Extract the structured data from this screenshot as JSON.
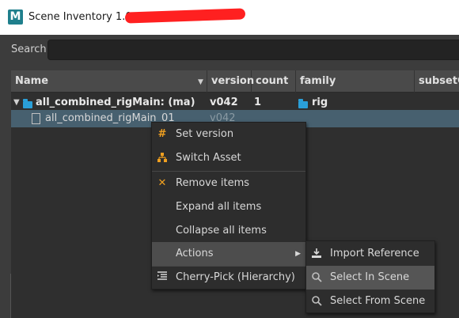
{
  "window": {
    "app_icon_letter": "M",
    "title": "Scene Inventory 1.0 -"
  },
  "search": {
    "label": "Search",
    "placeholder": ""
  },
  "columns": {
    "name": "Name",
    "version": "version",
    "count": "count",
    "family": "family",
    "subset": "subsetGroup"
  },
  "rows": [
    {
      "name": "all_combined_rigMain: (ma)",
      "version": "v042",
      "count": "1",
      "family": "rig"
    },
    {
      "name": "all_combined_rigMain_01",
      "version": "v042"
    }
  ],
  "context_menu": {
    "items": [
      {
        "label": "Set version",
        "icon": "hash-icon"
      },
      {
        "label": "Switch Asset",
        "icon": "hierarchy-icon"
      },
      {
        "label": "Remove items",
        "icon": "close-icon"
      },
      {
        "label": "Expand all items",
        "icon": ""
      },
      {
        "label": "Collapse all items",
        "icon": ""
      },
      {
        "label": "Actions",
        "icon": "",
        "submenu": true
      },
      {
        "label": "Cherry-Pick (Hierarchy)",
        "icon": "list-indent-icon"
      }
    ]
  },
  "actions_submenu": {
    "items": [
      {
        "label": "Import Reference",
        "icon": "download-icon"
      },
      {
        "label": "Select In Scene",
        "icon": "search-icon"
      },
      {
        "label": "Select From Scene",
        "icon": "search-icon"
      }
    ]
  },
  "colors": {
    "accent_folder": "#2a9fd8",
    "icon_orange": "#f0a020",
    "selection": "#47606f"
  }
}
